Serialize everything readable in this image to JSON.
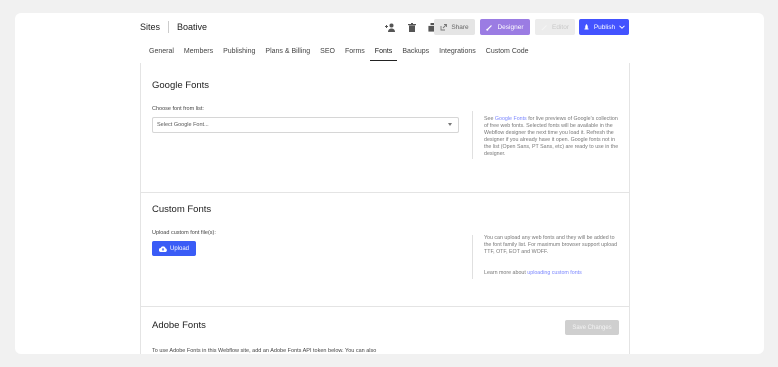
{
  "topbar": {
    "crumb_sites": "Sites",
    "crumb_site": "Boative",
    "icons": [
      "add-user-icon",
      "trash-icon",
      "duplicate-icon"
    ],
    "share_label": "Share",
    "designer_label": "Designer",
    "editor_label": "Editor",
    "publish_label": "Publish"
  },
  "tabs": [
    {
      "label": "General"
    },
    {
      "label": "Members"
    },
    {
      "label": "Publishing"
    },
    {
      "label": "Plans & Billing"
    },
    {
      "label": "SEO"
    },
    {
      "label": "Forms"
    },
    {
      "label": "Fonts",
      "active": true
    },
    {
      "label": "Backups"
    },
    {
      "label": "Integrations"
    },
    {
      "label": "Custom Code"
    }
  ],
  "google_fonts": {
    "title": "Google Fonts",
    "choose_label": "Choose font from list:",
    "select_value": "Select Google Font...",
    "help_prefix": "See ",
    "help_link": "Google Fonts",
    "help_rest": " for live previews of Google's collection of free web fonts. Selected fonts will be available in the Webflow designer the next time you load it. Refresh the designer if you already have it open. Google fonts not in the list (Open Sans, PT Sans, etc) are ready to use in the designer."
  },
  "custom_fonts": {
    "title": "Custom Fonts",
    "upload_label": "Upload custom font file(s):",
    "upload_button": "Upload",
    "help_text": "You can upload any web fonts and they will be added to the font family list. For maximum browser support upload TTF, OTF, EOT and WOFF.",
    "learn_prefix": "Learn more about ",
    "learn_link": "uploading custom fonts"
  },
  "adobe_fonts": {
    "title": "Adobe Fonts",
    "save_button": "Save Changes",
    "description": "To use Adobe Fonts in this Webflow site, add an Adobe Fonts API token below. You can also"
  },
  "colors": {
    "designer": "#9b7ce3",
    "publish": "#4353ff",
    "upload": "#3a5cf6",
    "link": "#7a86ff"
  }
}
